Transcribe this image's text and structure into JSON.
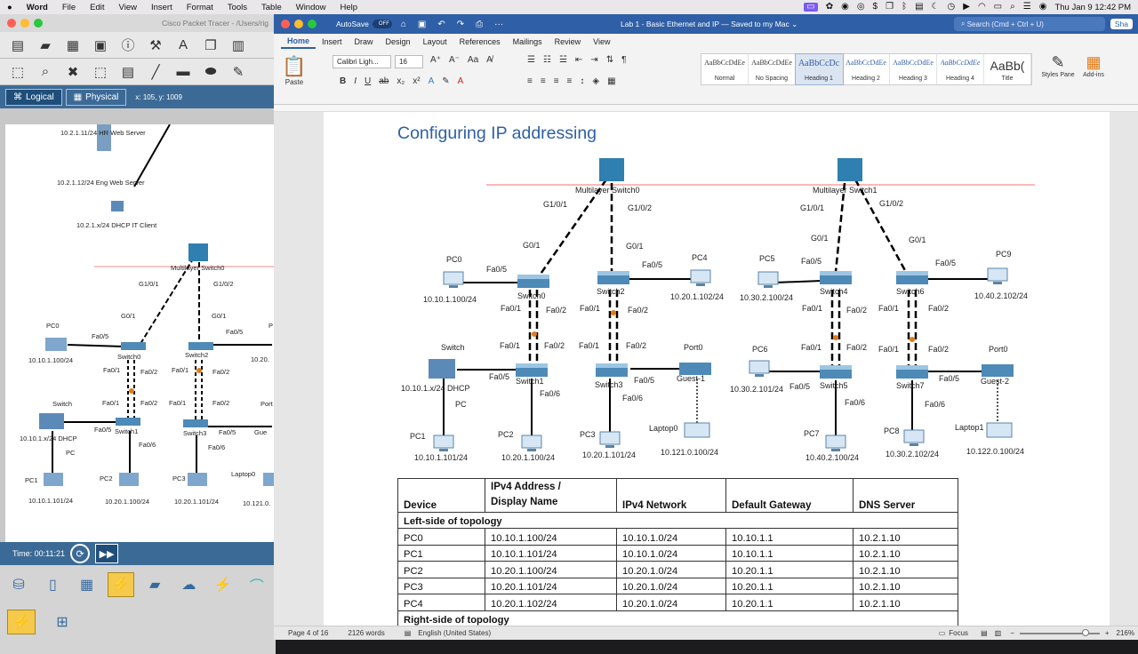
{
  "menubar": {
    "app": "Word",
    "items": [
      "File",
      "Edit",
      "View",
      "Insert",
      "Format",
      "Tools",
      "Table",
      "Window",
      "Help"
    ],
    "clock": "Thu Jan 9  12:42 PM"
  },
  "packet_tracer": {
    "window_title": "Cisco Packet Tracer - /Users/rig",
    "mode_tabs": [
      "Logical",
      "Physical"
    ],
    "coords": "x: 105, y: 1009",
    "time": "Time: 00:11:21",
    "labels": {
      "hr": "10.2.1.11/24 HR Web Server",
      "eng": "10.2.1.12/24 Eng Web Server",
      "dhcpit": "10.2.1.x/24 DHCP IT Client",
      "msw": "Multilayer Switch0",
      "g101": "G1/0/1",
      "g102": "G1/0/2",
      "g01a": "G0/1",
      "g01b": "G0/1",
      "pc0": "PC0",
      "fa05a": "Fa0/5",
      "fa05b": "Fa0/5",
      "p": "P",
      "pc0ip": "10.10.1.100/24",
      "ip20": "10.20.",
      "sw0": "Switch0",
      "sw2": "Switch2",
      "fa01a": "Fa0/1",
      "fa02a": "Fa0/2",
      "fa01b": "Fa0/1",
      "fa02b": "Fa0/2",
      "fa01c": "Fa0/1",
      "fa02c": "Fa0/2",
      "fa01d": "Fa0/1",
      "fa02d": "Fa0/2",
      "switch": "Switch",
      "dhcp": "10.10.1.x/24  DHCP",
      "pc": "PC",
      "fa05c": "Fa0/5",
      "sw1": "Switch1",
      "fa06a": "Fa0/6",
      "sw3": "Switch3",
      "fa05d": "Fa0/5",
      "gue": "Gue",
      "port": "Port",
      "fa06b": "Fa0/6",
      "pc1": "PC1",
      "pc2": "PC2",
      "pc3": "PC3",
      "lap0": "Laptop0",
      "pc1ip": "10.10.1.101/24",
      "pc2ip": "10.20.1.100/24",
      "pc3ip": "10.20.1.101/24",
      "lap0ip": "10.121.0."
    }
  },
  "word": {
    "autosave": "AutoSave",
    "toggle": "OFF",
    "doc_title": "Lab 1 - Basic Ethernet and IP — Saved to my Mac ⌄",
    "search": "Search (Cmd + Ctrl + U)",
    "share": "Sha",
    "tabs": [
      "Home",
      "Insert",
      "Draw",
      "Design",
      "Layout",
      "References",
      "Mailings",
      "Review",
      "View"
    ],
    "font": "Calibri Ligh...",
    "size": "16",
    "paste": "Paste",
    "styles": [
      {
        "preview": "AaBbCcDdEe",
        "name": "Normal"
      },
      {
        "preview": "AaBbCcDdEe",
        "name": "No Spacing"
      },
      {
        "preview": "AaBbCcDc",
        "name": "Heading 1"
      },
      {
        "preview": "AaBbCcDdEe",
        "name": "Heading 2"
      },
      {
        "preview": "AaBbCcDdEe",
        "name": "Heading 3"
      },
      {
        "preview": "AaBbCcDdEe",
        "name": "Heading 4"
      },
      {
        "preview": "AaBb(",
        "name": "Title"
      }
    ],
    "styles_pane": "Styles Pane",
    "addins": "Add-ins",
    "heading": "Configuring IP addressing",
    "diagram": {
      "msw0": "Multilayer Switch0",
      "msw1": "Multilayer Switch1",
      "g101a": "G1/0/1",
      "g102a": "G1/0/2",
      "g101b": "G1/0/1",
      "g102b": "G1/0/2",
      "g01a": "G0/1",
      "g01b": "G0/1",
      "g01c": "G0/1",
      "g01d": "G0/1",
      "pc0": "PC0",
      "pc0ip": "10.10.1.100/24",
      "fa05a": "Fa0/5",
      "sw0": "Switch0",
      "sw2": "Switch2",
      "fa05b": "Fa0/5",
      "pc4": "PC4",
      "pc4ip": "10.20.1.102/24",
      "pc5": "PC5",
      "pc5ip": "10.30.2.100/24",
      "fa05c": "Fa0/5",
      "sw4": "Switch4",
      "sw6": "Switch6",
      "fa05d": "Fa0/5",
      "pc9": "PC9",
      "pc9ip": "10.40.2.102/24",
      "fa01a": "Fa0/1",
      "fa02a": "Fa0/2",
      "fa01b": "Fa0/1",
      "fa02b": "Fa0/2",
      "fa01c": "Fa0/1",
      "fa02c": "Fa0/2",
      "fa01d": "Fa0/1",
      "fa02d": "Fa0/2",
      "fa01e": "Fa0/1",
      "fa02e": "Fa0/2",
      "fa01f": "Fa0/1",
      "fa02f": "Fa0/2",
      "fa01g": "Fa0/1",
      "fa02g": "Fa0/2",
      "fa01h": "Fa0/1",
      "fa02h": "Fa0/2",
      "switch": "Switch",
      "dhcp": "10.10.1.x/24  DHCP",
      "pc": "PC",
      "fa05e": "Fa0/5",
      "sw1": "Switch1",
      "fa06a": "Fa0/6",
      "sw3": "Switch3",
      "fa05f": "Fa0/5",
      "port0a": "Port0",
      "guest1": "Guest-1",
      "fa06b": "Fa0/6",
      "pc6": "PC6",
      "pc6ip": "10.30.2.101/24",
      "fa05g": "Fa0/5",
      "sw5": "Switch5",
      "fa06c": "Fa0/6",
      "sw7": "Switch7",
      "fa05h": "Fa0/5",
      "port0b": "Port0",
      "guest2": "Guest-2",
      "fa06d": "Fa0/6",
      "pc1": "PC1",
      "pc1ip": "10.10.1.101/24",
      "pc2": "PC2",
      "pc2ip": "10.20.1.100/24",
      "pc3": "PC3",
      "pc3ip": "10.20.1.101/24",
      "lap0": "Laptop0",
      "lap0ip": "10.121.0.100/24",
      "pc7": "PC7",
      "pc7ip": "10.40.2.100/24",
      "pc8": "PC8",
      "pc8ip": "10.30.2.102/24",
      "lap1": "Laptop1",
      "lap1ip": "10.122.0.100/24"
    },
    "table": {
      "headers": [
        "Device",
        "IPv4 Address / Display Name",
        "IPv4 Network",
        "Default Gateway",
        "DNS Server"
      ],
      "header_line1": "IPv4 Address /",
      "header_line2": "Display Name",
      "section_left": "Left-side of topology",
      "rows": [
        [
          "PC0",
          "10.10.1.100/24",
          "10.10.1.0/24",
          "10.10.1.1",
          "10.2.1.10"
        ],
        [
          "PC1",
          "10.10.1.101/24",
          "10.10.1.0/24",
          "10.10.1.1",
          "10.2.1.10"
        ],
        [
          "PC2",
          "10.20.1.100/24",
          "10.20.1.0/24",
          "10.20.1.1",
          "10.2.1.10"
        ],
        [
          "PC3",
          "10.20.1.101/24",
          "10.20.1.0/24",
          "10.20.1.1",
          "10.2.1.10"
        ],
        [
          "PC4",
          "10.20.1.102/24",
          "10.20.1.0/24",
          "10.20.1.1",
          "10.2.1.10"
        ]
      ],
      "section_right": "Right-side of topology"
    },
    "status": {
      "page": "Page 4 of 16",
      "words": "2126 words",
      "lang": "English (United States)",
      "focus": "Focus",
      "zoom": "216%"
    }
  }
}
